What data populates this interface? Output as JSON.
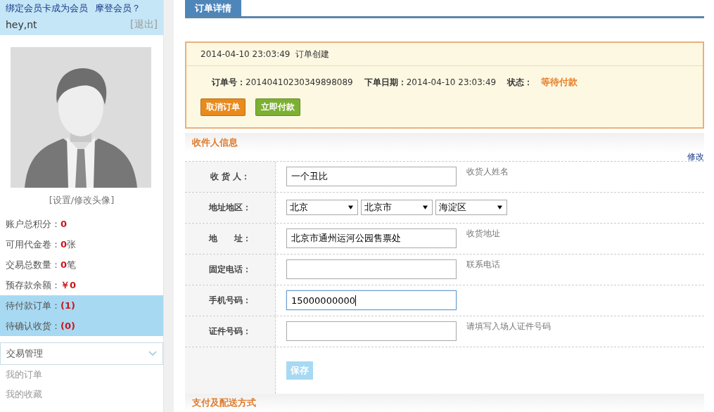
{
  "sidebar": {
    "member_prompt": {
      "bind_link": "绑定会员卡成为会员",
      "modern_link": "摩登会员？"
    },
    "username": "hey,nt",
    "logout": "[退出]",
    "avatar_link": "[设置/修改头像]",
    "stats": [
      {
        "label": "账户总积分：",
        "value": "0",
        "highlighted": false
      },
      {
        "label": "可用代金卷：",
        "value": "0",
        "unit": "张",
        "highlighted": false
      },
      {
        "label": "交易总数量：",
        "value": "0",
        "unit": "笔",
        "highlighted": false
      },
      {
        "label": "预存款余额：",
        "value": "￥0",
        "highlighted": false
      },
      {
        "label": "待付款订单：",
        "value": "(1)",
        "highlighted": true
      },
      {
        "label": "待确认收货：",
        "value": "(0)",
        "highlighted": true
      }
    ],
    "menu_group": {
      "title": "交易管理",
      "expanded": true
    },
    "menu_items": [
      "我的订单",
      "我的收藏"
    ]
  },
  "tab": {
    "label": "订单详情",
    "selected": true
  },
  "order": {
    "log_time": "2014-04-10 23:03:49",
    "log_event": "订单创建",
    "number_label": "订单号：",
    "number": "20140410230349898089",
    "date_label": "下单日期：",
    "date": "2014-04-10 23:03:49",
    "status_label": "状态：",
    "status": "等待付款",
    "buttons": [
      {
        "label": "取消订单",
        "color": "#e98a1c"
      },
      {
        "label": "立即付款",
        "color": "#7cb032"
      }
    ]
  },
  "recipient": {
    "title": "收件人信息",
    "edit_link": "修改",
    "rows": [
      {
        "kind": "text",
        "label": "收 货 人：",
        "value": "一个丑比",
        "hint": "收货人姓名",
        "focused": false
      },
      {
        "kind": "select",
        "label": "地址地区：",
        "options": [
          "北京",
          "北京市",
          "海淀区"
        ]
      },
      {
        "kind": "text",
        "label": "地　　址：",
        "value": "北京市通州运河公园售票处",
        "hint": "收货地址",
        "focused": false
      },
      {
        "kind": "text",
        "label": "固定电话：",
        "hint": "联系电话",
        "focused": false
      },
      {
        "kind": "text",
        "label": "手机号码：",
        "value": "15000000000",
        "focused": true
      },
      {
        "kind": "text",
        "label": "证件号码：",
        "hint": "请填写入场人证件号码",
        "focused": false
      }
    ],
    "save_button": {
      "label": "保存",
      "disabled": true
    }
  },
  "next_section": {
    "title": "支付及配送方式"
  }
}
